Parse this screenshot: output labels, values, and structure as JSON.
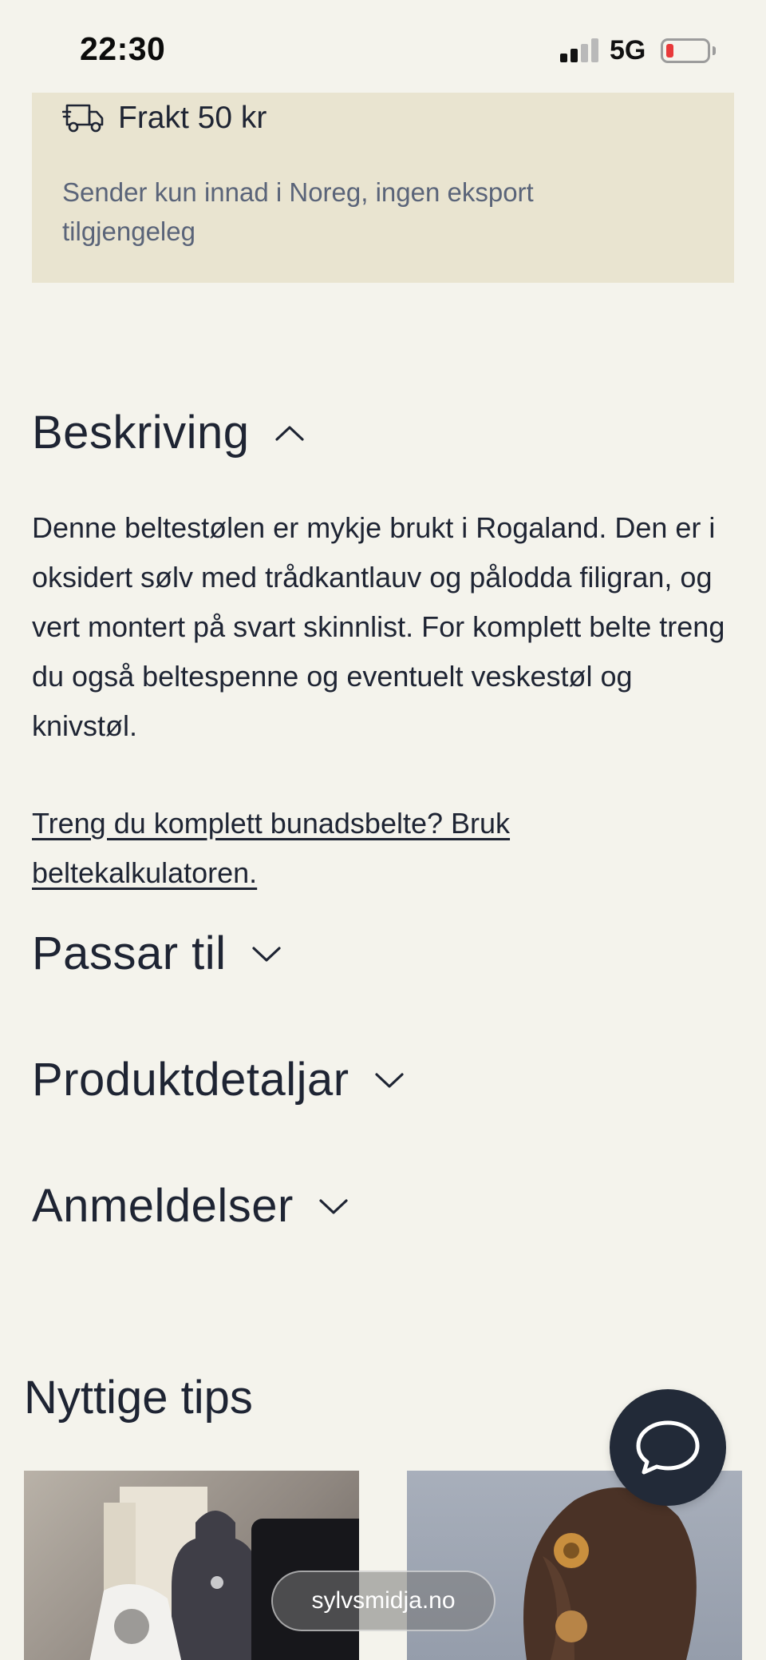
{
  "status_bar": {
    "time": "22:30",
    "network": "5G",
    "battery_color": "#e8393a"
  },
  "shipping": {
    "icon": "truck-icon",
    "title": "Frakt 50 kr",
    "note": "Sender kun innad i Noreg, ingen eksport tilgjengeleg"
  },
  "description": {
    "heading": "Beskriving",
    "expanded": true,
    "body": "Denne beltestølen er mykje brukt i Rogaland. Den er i oksidert sølv med trådkantlauv og pålodda filigran, og vert montert på svart skinnlist. For komplett belte treng du også beltespenne og eventuelt veskestøl og knivstøl.",
    "link": "Treng du komplett bunadsbelte? Bruk beltekalkulatoren."
  },
  "accordions": [
    {
      "heading": "Passar til",
      "expanded": false
    },
    {
      "heading": "Produktdetaljar",
      "expanded": false
    },
    {
      "heading": "Anmeldelser",
      "expanded": false
    }
  ],
  "tips": {
    "heading": "Nyttige tips"
  },
  "chat": {
    "icon": "chat-bubble-icon"
  },
  "browser": {
    "url": "sylvsmidja.no"
  },
  "colors": {
    "background": "#f4f3ec",
    "shipping_bg": "#e9e4d0",
    "text": "#1e2433",
    "muted": "#5a6479",
    "chat_bg": "#222a38"
  }
}
